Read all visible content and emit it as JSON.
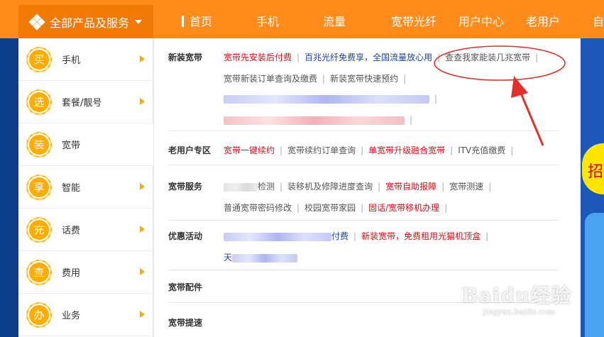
{
  "nav": {
    "all_products": "全部产品及服务",
    "items": [
      "首页",
      "手机",
      "流量",
      "宽带光纤",
      "用户中心",
      "老用户",
      "自"
    ]
  },
  "sidebar": {
    "items": [
      {
        "badge": "买",
        "label": "手机",
        "arrow": true
      },
      {
        "badge": "选",
        "label": "套餐/靓号",
        "arrow": true
      },
      {
        "badge": "装",
        "label": "宽带",
        "arrow": false
      },
      {
        "badge": "享",
        "label": "智能",
        "arrow": true
      },
      {
        "badge": "充",
        "label": "话费",
        "arrow": true
      },
      {
        "badge": "查",
        "label": "费用",
        "arrow": true
      },
      {
        "badge": "办",
        "label": "业务",
        "arrow": true
      }
    ]
  },
  "sections": {
    "new_install": {
      "title": "新装宽带",
      "row1": [
        "宽带先安装后付费",
        "百兆光纤免费享，全国流量放心用",
        "查查我家能装几兆宽带"
      ],
      "row2": [
        "宽带新装订单查询及缴费",
        "新装宽带快速预约"
      ]
    },
    "old_user": {
      "title": "老用户专区",
      "row1": [
        "宽带一键续约",
        "宽带续约订单查询",
        "单宽带升级融合宽带",
        "ITV充值缴费"
      ]
    },
    "service": {
      "title": "宽带服务",
      "row1_suffix": "检测",
      "row1": [
        "装移机及修障进度查询",
        "宽带自助报障",
        "宽带测速"
      ],
      "row2": [
        "普通宽带密码修改",
        "校园宽带家园",
        "固话/宽带移机办理"
      ]
    },
    "promo": {
      "title": "优惠活动",
      "row1_suffix": "付费",
      "row1": [
        "新装宽带，免费租用光猫机顶盒"
      ],
      "row2_prefix": "天"
    },
    "accessories": {
      "title": "宽带配件"
    },
    "speedup": {
      "title": "宽带提速"
    }
  },
  "right_promo": {
    "text": "招"
  },
  "watermark": {
    "main": "Baidu经验",
    "sub": "jingyan.baidu.com"
  },
  "colors": {
    "nav_orange": "#ff8c1a",
    "link_red": "#d6101b",
    "link_blue": "#1a3fa8",
    "badge_orange": "#ffab00",
    "annotation_red": "#e0322b"
  }
}
